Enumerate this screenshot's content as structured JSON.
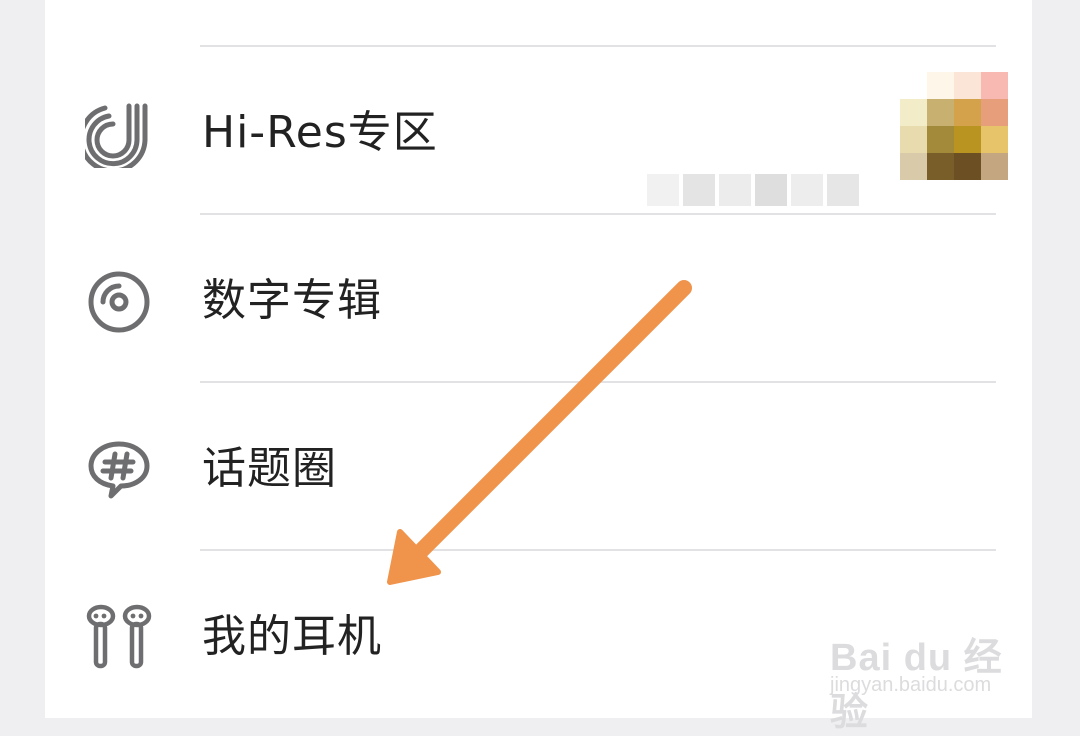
{
  "menu": {
    "items": [
      {
        "label": "Hi-Res专区",
        "icon": "hi-res-icon"
      },
      {
        "label": "数字专辑",
        "icon": "disc-icon"
      },
      {
        "label": "话题圈",
        "icon": "hashtag-chat-icon"
      },
      {
        "label": "我的耳机",
        "icon": "earbuds-icon"
      }
    ]
  },
  "annotation": {
    "arrow_color": "#f0934b",
    "icon": "pointer-arrow"
  },
  "watermark": {
    "brand": "Bai du 经验",
    "url": "jingyan.baidu.com"
  },
  "colors": {
    "background": "#efeff1",
    "panel": "#ffffff",
    "divider": "#e2e2e4",
    "icon_stroke": "#6e6e70"
  }
}
